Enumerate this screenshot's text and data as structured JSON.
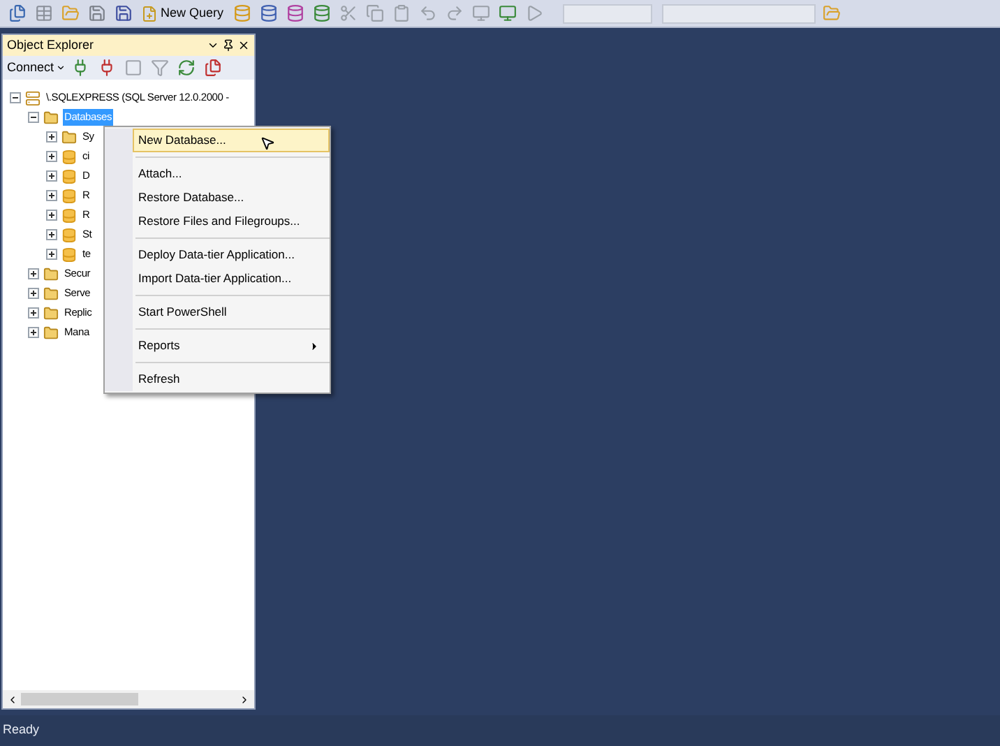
{
  "toolbar": {
    "new_query": "New Query"
  },
  "object_explorer": {
    "title": "Object Explorer",
    "connect": "Connect",
    "tree": [
      {
        "label": "\\.SQLEXPRESS (SQL Server 12.0.2000 -",
        "kind": "server",
        "expanded": true,
        "selected": false,
        "children": [
          {
            "label": "Databases",
            "kind": "folder",
            "expanded": true,
            "selected": true,
            "children": [
              {
                "label": "Sy",
                "kind": "folder",
                "expanded": false,
                "selected": false
              },
              {
                "label": "ci",
                "kind": "database",
                "expanded": false,
                "selected": false
              },
              {
                "label": "D",
                "kind": "database",
                "expanded": false,
                "selected": false
              },
              {
                "label": "R",
                "kind": "database",
                "expanded": false,
                "selected": false
              },
              {
                "label": "R",
                "kind": "database",
                "expanded": false,
                "selected": false
              },
              {
                "label": "St",
                "kind": "database",
                "expanded": false,
                "selected": false
              },
              {
                "label": "te",
                "kind": "database",
                "expanded": false,
                "selected": false
              }
            ]
          },
          {
            "label": "Secur",
            "kind": "folder",
            "expanded": false,
            "selected": false
          },
          {
            "label": "Serve",
            "kind": "folder",
            "expanded": false,
            "selected": false
          },
          {
            "label": "Replic",
            "kind": "folder",
            "expanded": false,
            "selected": false
          },
          {
            "label": "Mana",
            "kind": "folder",
            "expanded": false,
            "selected": false
          }
        ]
      }
    ]
  },
  "context_menu": [
    {
      "kind": "item",
      "label": "New Database...",
      "selected": true,
      "submenu": false
    },
    {
      "kind": "separator"
    },
    {
      "kind": "item",
      "label": "Attach...",
      "selected": false,
      "submenu": false
    },
    {
      "kind": "item",
      "label": "Restore Database...",
      "selected": false,
      "submenu": false
    },
    {
      "kind": "item",
      "label": "Restore Files and Filegroups...",
      "selected": false,
      "submenu": false
    },
    {
      "kind": "separator"
    },
    {
      "kind": "item",
      "label": "Deploy Data-tier Application...",
      "selected": false,
      "submenu": false
    },
    {
      "kind": "item",
      "label": "Import Data-tier Application...",
      "selected": false,
      "submenu": false
    },
    {
      "kind": "separator"
    },
    {
      "kind": "item",
      "label": "Start PowerShell",
      "selected": false,
      "submenu": false
    },
    {
      "kind": "separator"
    },
    {
      "kind": "item",
      "label": "Reports",
      "selected": false,
      "submenu": true
    },
    {
      "kind": "separator"
    },
    {
      "kind": "item",
      "label": "Refresh",
      "selected": false,
      "submenu": false
    }
  ],
  "status_bar": {
    "text": "Ready"
  }
}
